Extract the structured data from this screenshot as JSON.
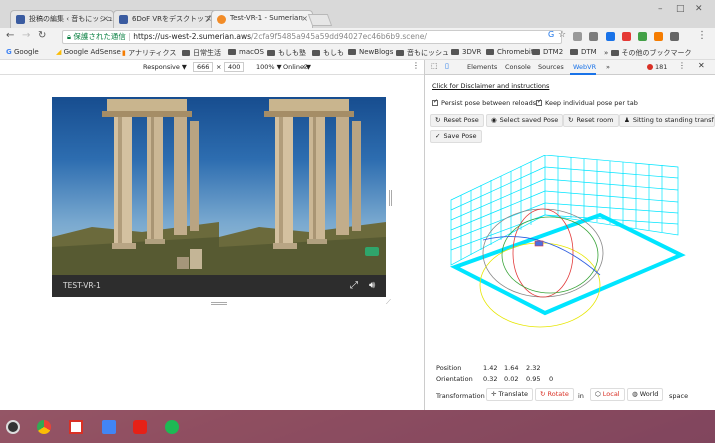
{
  "tabs": [
    {
      "title": "投稿の編集 ‹ 音もにッシュ",
      "favicon_color": "#3a5ba0"
    },
    {
      "title": "6DoF VRをデスクトップ",
      "favicon_color": "#3a5ba0"
    },
    {
      "title": "Test-VR-1 - Sumerian",
      "favicon_color": "#f28c28"
    }
  ],
  "address": {
    "secure_label": "保護された通信",
    "host": "https://us-west-2.sumerian.aws",
    "path": "/2cfa9f5485a945a59dd94027ec46b6b9.scene/"
  },
  "bookmarks": [
    "Google",
    "Google AdSense",
    "アナリティクス",
    "日常生活",
    "macOS",
    "もしも塾",
    "もしも",
    "NewBlogs",
    "音もにッシュ",
    "3DVR",
    "Chromebit",
    "DTM2",
    "DTM",
    "その他のブックマーク"
  ],
  "device_bar": {
    "mode": "Responsive ▼",
    "width": "666",
    "times": "×",
    "height": "400",
    "zoom": "100% ▼",
    "network": "Online ▼"
  },
  "viewer": {
    "title": "TEST-VR-1"
  },
  "devtools": {
    "tabs": [
      "Elements",
      "Console",
      "Sources",
      "WebVR",
      "»"
    ],
    "error_count": "181",
    "disclaimer_link": "Click for Disclaimer and instructions",
    "persist_label": "Persist pose between reloads",
    "keep_label": "Keep individual pose per tab",
    "buttons": {
      "reset_pose": "Reset Pose",
      "select_saved": "Select saved Pose",
      "reset_room": "Reset room",
      "sitting": "Sitting to standing transform",
      "save_pose": "Save Pose"
    },
    "position_label": "Position",
    "position_values": [
      "1.42",
      "1.64",
      "2.32"
    ],
    "orientation_label": "Orientation",
    "orientation_values": [
      "0.32",
      "0.02",
      "0.95",
      "0"
    ],
    "transformation_label": "Transformation",
    "translate": "Translate",
    "rotate": "Rotate",
    "in_label": "in",
    "local": "Local",
    "world": "World",
    "space_label": "space"
  },
  "colors": {
    "accent": "#1a73e8",
    "grid": "#00e5ff",
    "error": "#d93025"
  }
}
